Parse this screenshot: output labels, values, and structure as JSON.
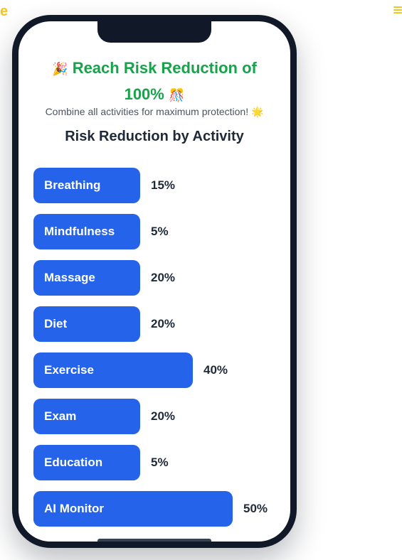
{
  "topbar": {
    "edge_glyph": "e"
  },
  "screen": {
    "headline_prefix": "🎉",
    "headline_text": "Reach Risk Reduction of 100%",
    "headline_suffix": "🎊",
    "subtitle_text": "Combine all activities for maximum protection!",
    "subtitle_emoji": "🌟",
    "section_title": "Risk Reduction by Activity"
  },
  "chart_data": {
    "type": "bar",
    "title": "Risk Reduction by Activity",
    "categories": [
      "Breathing",
      "Mindfulness",
      "Massage",
      "Diet",
      "Exercise",
      "Exam",
      "Education",
      "AI Monitor"
    ],
    "values": [
      15,
      5,
      20,
      20,
      40,
      20,
      5,
      50
    ],
    "value_labels": [
      "15%",
      "5%",
      "20%",
      "20%",
      "40%",
      "20%",
      "5%",
      "50%"
    ],
    "unit": "%",
    "bar_color": "#2563eb",
    "orientation": "horizontal"
  },
  "colors": {
    "accent_green": "#16a34a",
    "bar_blue": "#2563eb",
    "phone_frame": "#111827",
    "menu_yellow": "#f5c518"
  }
}
